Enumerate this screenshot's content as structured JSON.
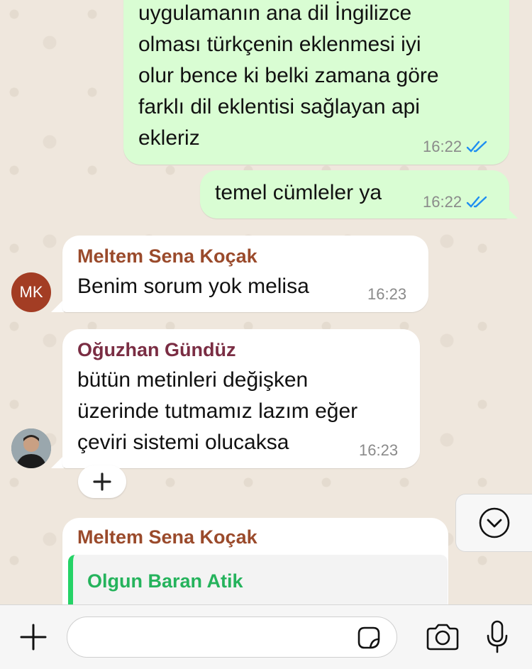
{
  "colors": {
    "chat_bg": "#efe7dd",
    "outgoing_bubble": "#d9fdd3",
    "incoming_bubble": "#ffffff",
    "read_ticks": "#1f8ef1",
    "sender_meltem": "#9a4a2b",
    "sender_oguzhan": "#7a2d43",
    "sender_olgun": "#25b35c",
    "avatar_mk": "#a33d24"
  },
  "messages": [
    {
      "id": "out1",
      "direction": "outgoing",
      "text": "uygulamanın ana dil İngilizce\nolması türkçenin eklenmesi iyi\nolur bence ki belki zamana göre\nfarklı dil eklentisi sağlayan api\nekleriz",
      "time": "16:22",
      "status_icon": "double-check-read-icon"
    },
    {
      "id": "out2",
      "direction": "outgoing",
      "text": "temel cümleler ya",
      "time": "16:22",
      "status_icon": "double-check-read-icon"
    },
    {
      "id": "in1",
      "direction": "incoming",
      "sender": "Meltem Sena Koçak",
      "avatar_initials": "MK",
      "text": "Benim sorum yok melisa",
      "time": "16:23"
    },
    {
      "id": "in2",
      "direction": "incoming",
      "sender": "Oğuzhan Gündüz",
      "avatar_icon": "profile-photo",
      "text": "bütün metinleri değişken\nüzerinde tutmamız lazım eğer\nçeviri sistemi olucaksa",
      "time": "16:23",
      "reaction_button_icon": "plus-icon"
    },
    {
      "id": "in3",
      "direction": "incoming",
      "sender": "Meltem Sena Koçak",
      "quoted_sender": "Olgun Baran Atik"
    }
  ],
  "scroll_button_icon": "chevron-down-circle-icon",
  "input_bar": {
    "placeholder": "",
    "attach_icon": "plus-icon",
    "sticker_icon": "sticker-icon",
    "camera_icon": "camera-icon",
    "mic_icon": "microphone-icon"
  }
}
